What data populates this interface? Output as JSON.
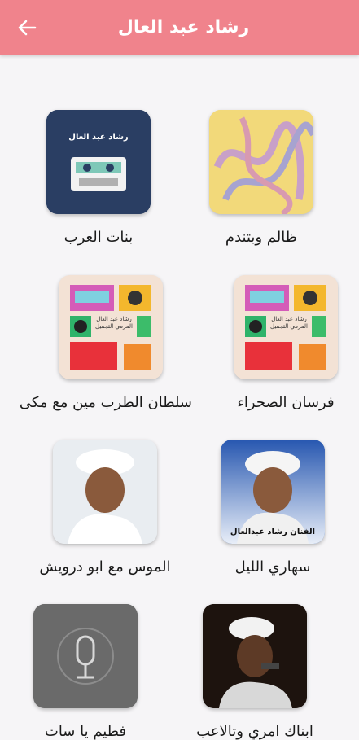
{
  "header": {
    "title": "رشاد عبد العال"
  },
  "items": [
    {
      "label": "ظالم وبتندم"
    },
    {
      "label": "بنات العرب",
      "cover_text": "رشاد عبد العال"
    },
    {
      "label": "فرسان الصحراء",
      "cover_text": "رشاد عبد العال المرمي التجميل"
    },
    {
      "label": "سلطان الطرب مين مع مكى",
      "cover_text": "رشاد عبد العال المرمي التجميل"
    },
    {
      "label": "سهاري الليل",
      "cover_text": "الفنان رشاد عبدالعال"
    },
    {
      "label": "الموس مع ابو درويش"
    },
    {
      "label": "ابناك امري وتالاعب"
    },
    {
      "label": "فطيم يا سات"
    }
  ],
  "colors": {
    "accent": "#f0838c",
    "background": "#f6f5f7"
  }
}
